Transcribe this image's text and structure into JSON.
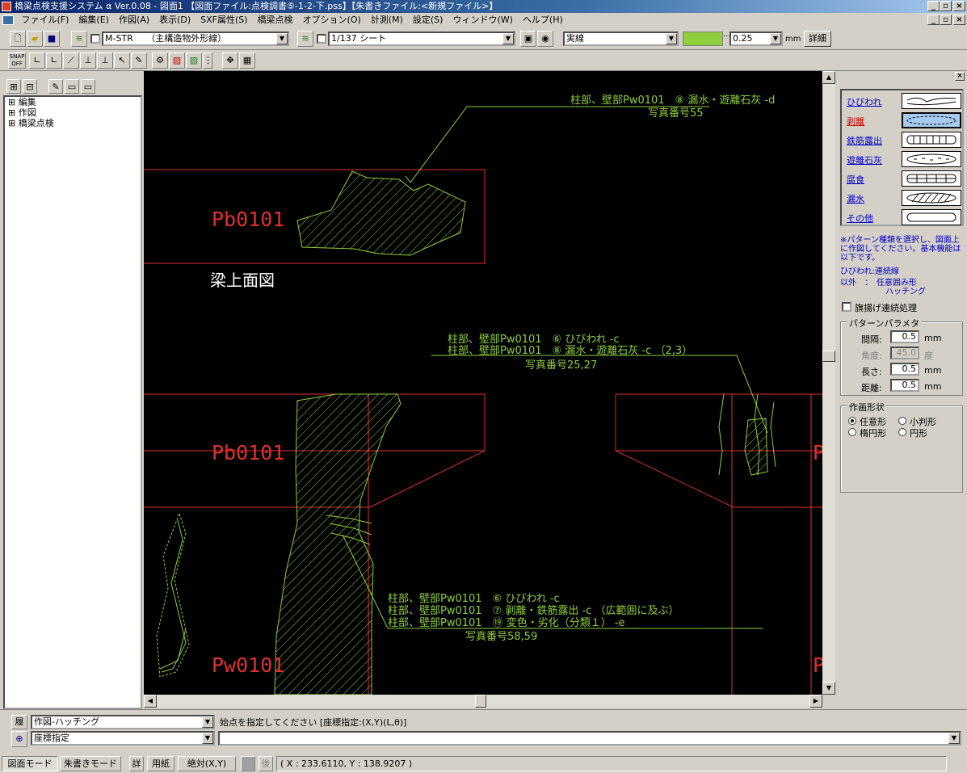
{
  "window": {
    "title": "橋梁点検支援システム α Ver.0.08 - 図面1 【図面ファイル:点検調書⑤-1-2-下.pss】【朱書きファイル:<新規ファイル>】"
  },
  "menu": [
    "ファイル(F)",
    "編集(E)",
    "作図(A)",
    "表示(D)",
    "SXF属性(S)",
    "橋梁点検",
    "オプション(O)",
    "計測(M)",
    "設定(S)",
    "ウィンドウ(W)",
    "ヘルプ(H)"
  ],
  "toolbar": {
    "layer_value": "M-STR　　（主構造物外形線）",
    "sheet_value": "1/137 シート",
    "linetype_value": "実線",
    "line_color": "#8fce3c",
    "width_value": "0.25",
    "width_unit": "mm",
    "detail_label": "詳細",
    "snap_label": "SNAP OFF"
  },
  "tree": [
    "編集",
    "作図",
    "橋梁点検"
  ],
  "canvas": {
    "labels": {
      "pb1": "Pb0101",
      "pb2": "Pb0101",
      "pw1": "Pw0101",
      "plan_title": "梁上面図",
      "edge_p1": "P",
      "edge_p2": "P"
    },
    "ann1": [
      "柱部、壁部Pw0101　⑧ 漏水・遊離石灰 -d",
      "写真番号55"
    ],
    "ann2": [
      "柱部、壁部Pw0101　⑥ ひびわれ -c",
      "柱部、壁部Pw0101　⑧ 漏水・遊離石灰 -c （2,3）",
      "写真番号25,27"
    ],
    "ann3": [
      "柱部、壁部Pw0101　⑥ ひびわれ -c",
      "柱部、壁部Pw0101　⑦ 剥離・鉄筋露出 -c （広範囲に及ぶ）",
      "柱部、壁部Pw0101　⑲ 変色・劣化（分類１） -e",
      "写真番号58,59"
    ]
  },
  "panel": {
    "patterns": [
      "ひびわれ",
      "剥離",
      "鉄筋露出",
      "遊離石灰",
      "腐食",
      "漏水",
      "その他"
    ],
    "selected_pattern": "剥離",
    "note1": "※パターン種類を選択し、図面上に作図してください。基本機能は以下です。",
    "note2_a": "ひびわれ:連続線",
    "note2_b": "以外　：　任意囲み形",
    "note2_c": "ハッチング",
    "flag_label": "旗揚げ連続処理",
    "param_title": "パターンパラメタ",
    "params": [
      {
        "label": "間隔:",
        "value": "0.5",
        "unit": "mm"
      },
      {
        "label": "角度:",
        "value": "45.0",
        "unit": "度"
      },
      {
        "label": "長さ:",
        "value": "0.5",
        "unit": "mm"
      },
      {
        "label": "距離:",
        "value": "0.5",
        "unit": "mm"
      }
    ],
    "shape_title": "作画形状",
    "shapes": [
      "任意形",
      "小判形",
      "楕円形",
      "円形"
    ],
    "selected_shape": "任意形"
  },
  "command": {
    "history_label": "履",
    "mode_value": "作図-ハッチング",
    "coord_value": "座標指定",
    "prompt": "始点を指定してください [座標指定:(X,Y)(L,θ)]",
    "input_value": ""
  },
  "status": {
    "drawing_mode": "図面モード",
    "redline_mode": "朱書きモード",
    "detail": "詳",
    "paper": "用紙",
    "absolute": "絶対(X,Y)",
    "after": "後",
    "coords": "( X : 233.6110, Y : 138.9207 )"
  }
}
